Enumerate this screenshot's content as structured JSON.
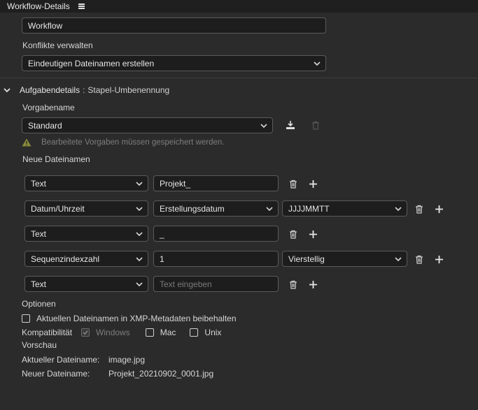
{
  "header": {
    "title": "Workflow-Details"
  },
  "workflow": {
    "name_value": "Workflow",
    "conflicts_label": "Konflikte verwalten",
    "conflicts_value": "Eindeutigen Dateinamen erstellen"
  },
  "task": {
    "title": "Aufgabendetails",
    "separator": ":",
    "type": "Stapel-Umbenennung"
  },
  "preset": {
    "label": "Vorgabename",
    "value": "Standard",
    "warning": "Bearbeitete Vorgaben müssen gespeichert werden."
  },
  "new_names": {
    "label": "Neue Dateinamen",
    "rows": [
      {
        "type": "Text",
        "value": "Projekt_",
        "placeholder": ""
      },
      {
        "type": "Datum/Uhrzeit",
        "option": "Erstellungsdatum",
        "format": "JJJJMMTT"
      },
      {
        "type": "Text",
        "value": "_",
        "placeholder": ""
      },
      {
        "type": "Sequenzindexzahl",
        "value": "1",
        "format": "Vierstellig"
      },
      {
        "type": "Text",
        "value": "",
        "placeholder": "Text eingeben"
      }
    ]
  },
  "options": {
    "label": "Optionen",
    "keep_xmp_label": "Aktuellen Dateinamen in XMP-Metadaten beibehalten",
    "compat_label": "Kompatibilität",
    "windows_label": "Windows",
    "mac_label": "Mac",
    "unix_label": "Unix"
  },
  "preview": {
    "label": "Vorschau",
    "current_label": "Aktueller Dateiname:",
    "current_value": "image.jpg",
    "new_label": "Neuer Dateiname:",
    "new_value": "Projekt_20210902_0001.jpg"
  },
  "colors": {
    "background": "#2b2b2b",
    "field_bg": "#1d1d1d",
    "field_border": "#5a5a5a",
    "header_bg": "#1f1f1f",
    "warning": "#8a8a3a"
  },
  "icons": {
    "menu": "hamburger-icon",
    "chevron": "chevron-down-icon",
    "trash": "trash-icon",
    "plus": "plus-icon",
    "save": "save-preset-icon",
    "warning": "warning-icon"
  }
}
